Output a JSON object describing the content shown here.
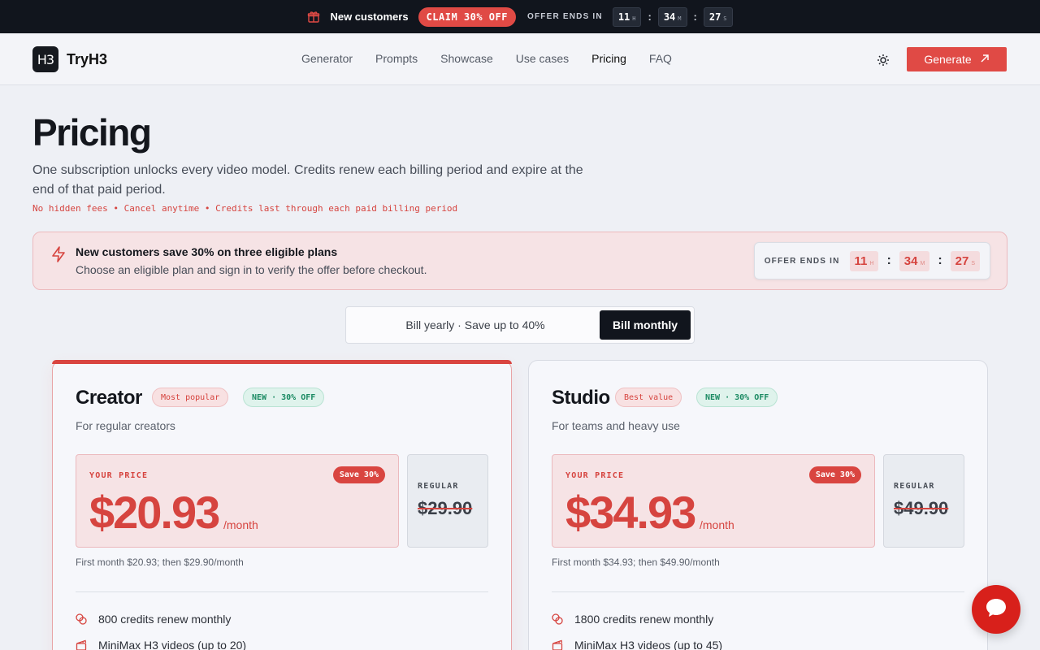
{
  "promo": {
    "label": "New customers",
    "claim": "CLAIM 30% OFF",
    "offer_ends": "OFFER ENDS IN",
    "hours": "11",
    "h_unit": "H",
    "minutes": "34",
    "m_unit": "M",
    "seconds": "27",
    "s_unit": "S"
  },
  "nav": {
    "brand": "TryH3",
    "logo_mark": "H3",
    "links": [
      "Generator",
      "Prompts",
      "Showcase",
      "Use cases",
      "Pricing",
      "FAQ"
    ],
    "active": "Pricing",
    "cta": "Generate"
  },
  "hero": {
    "title": "Pricing",
    "subtitle": "One subscription unlocks every video model. Credits renew each billing period and expire at the end of that paid period.",
    "note": "No hidden fees • Cancel anytime • Credits last through each paid billing period"
  },
  "offer": {
    "title": "New customers save 30% on three eligible plans",
    "body": "Choose an eligible plan and sign in to verify the offer before checkout.",
    "ends_label": "OFFER ENDS IN",
    "hours": "11",
    "h_unit": "H",
    "minutes": "34",
    "m_unit": "M",
    "seconds": "27",
    "s_unit": "S"
  },
  "billing": {
    "yearly": "Bill yearly · Save up to 40%",
    "monthly": "Bill monthly",
    "selected": "monthly"
  },
  "plans": [
    {
      "name": "Creator",
      "badge": "Most popular",
      "new_badge": "NEW · 30% OFF",
      "description": "For regular creators",
      "your_price_label": "YOUR PRICE",
      "save": "Save 30%",
      "price": "$20.93",
      "per": "/month",
      "regular_label": "REGULAR",
      "regular_price": "$29.90",
      "fine": "First month $20.93; then $29.90/month",
      "features": [
        "800 credits renew monthly",
        "MiniMax H3 videos (up to 20)"
      ]
    },
    {
      "name": "Studio",
      "badge": "Best value",
      "new_badge": "NEW · 30% OFF",
      "description": "For teams and heavy use",
      "your_price_label": "YOUR PRICE",
      "save": "Save 30%",
      "price": "$34.93",
      "per": "/month",
      "regular_label": "REGULAR",
      "regular_price": "$49.90",
      "fine": "First month $34.93; then $49.90/month",
      "features": [
        "1800 credits renew monthly",
        "MiniMax H3 videos (up to 45)"
      ]
    }
  ],
  "colors": {
    "accent": "#e04a45",
    "dark": "#11151d",
    "success": "#1a8a62",
    "chat": "#d8201b"
  },
  "icons": {
    "promo": "gift-icon",
    "offer": "bolt-icon",
    "theme": "sun-icon",
    "cta": "arrow-up-right-icon",
    "credits": "coins-icon",
    "videos": "clapperboard-icon",
    "chat": "chat-icon"
  }
}
